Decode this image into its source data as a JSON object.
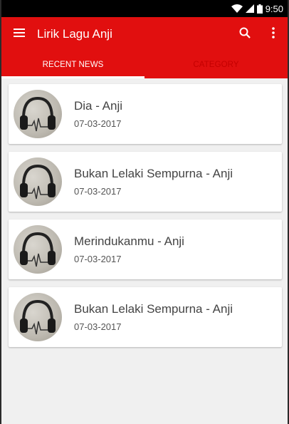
{
  "status_bar": {
    "time": "9:50"
  },
  "app_bar": {
    "title": "Lirik Lagu Anji"
  },
  "tabs": [
    {
      "label": "RECENT NEWS",
      "active": true
    },
    {
      "label": "CATEGORY",
      "active": false
    }
  ],
  "posts": [
    {
      "title": "Dia - Anji",
      "date": "07-03-2017"
    },
    {
      "title": "Bukan Lelaki Sempurna - Anji",
      "date": "07-03-2017"
    },
    {
      "title": "Merindukanmu - Anji",
      "date": "07-03-2017"
    },
    {
      "title": "Bukan Lelaki Sempurna - Anji",
      "date": "07-03-2017"
    }
  ],
  "colors": {
    "primary": "#e10f0f",
    "background": "#f0f0f0"
  },
  "icons": [
    "wifi-icon",
    "signal-icon",
    "battery-icon",
    "menu-icon",
    "search-icon",
    "more-vert-icon",
    "headphones-icon"
  ]
}
